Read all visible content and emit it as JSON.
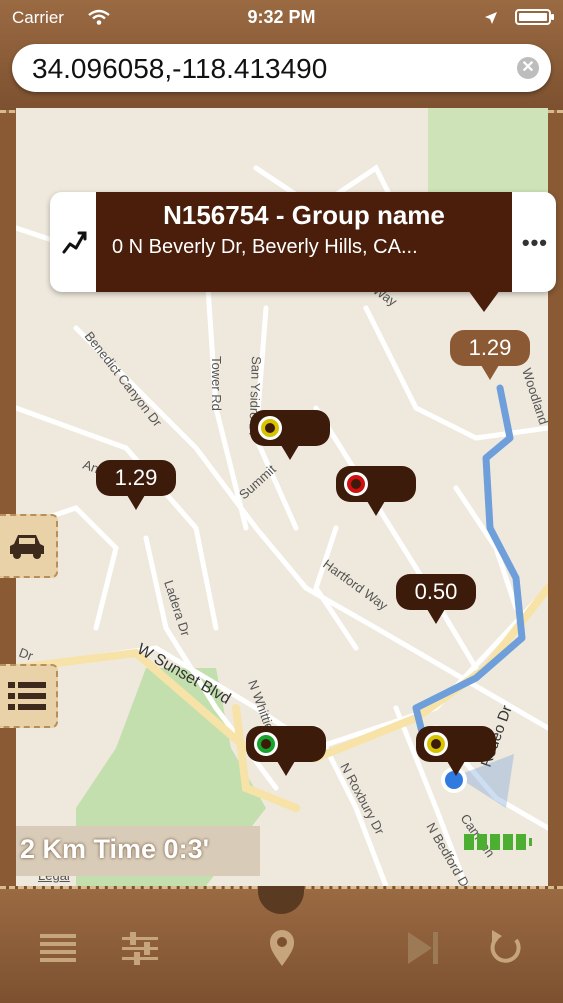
{
  "status_bar": {
    "carrier": "Carrier",
    "wifi_icon": "wifi-icon",
    "time": "9:32 PM",
    "location_icon": "location-arrow-icon",
    "battery_icon": "battery-icon"
  },
  "search": {
    "value": "34.096058,-118.413490",
    "clear_icon": "clear-icon",
    "clear_glyph": "✕"
  },
  "callout": {
    "title": "N156754 - Group name",
    "address": "0 N Beverly Dr, Beverly Hills, CA...",
    "route_icon": "route-icon",
    "more_icon": "more-icon",
    "more_glyph": "•••"
  },
  "map": {
    "streets": [
      "Benedict Canyon Dr",
      "Tower Rd",
      "San Ysidro Dr",
      "Summit",
      "Angelo Dr",
      "Hartford Way",
      "Ladera Dr",
      "W Sunset Blvd",
      "N Whittier",
      "N Roxbury Dr",
      "N Bedford Dr",
      "Rodeo Dr",
      "Woodland",
      "Way",
      "Dr",
      "Camden"
    ],
    "pins": [
      {
        "label": "1.29",
        "style": "tan"
      },
      {
        "label": "1.29",
        "style": "dark"
      },
      {
        "label": "",
        "style": "dark",
        "dot": "yellow"
      },
      {
        "label": "",
        "style": "dark",
        "dot": "red"
      },
      {
        "label": "0.50",
        "style": "dark"
      },
      {
        "label": "",
        "style": "dark",
        "dot": "green"
      },
      {
        "label": "",
        "style": "dark",
        "dot": "yellow"
      }
    ],
    "colors": {
      "route": "#6f9fdb",
      "pin_dark": "#3d1b0b",
      "pin_tan": "#8b5a34",
      "dot_yellow": "#d8c300",
      "dot_red": "#d01010",
      "dot_green": "#16a52a"
    },
    "legal": "Legal"
  },
  "side_tabs": [
    {
      "icon": "car-icon"
    },
    {
      "icon": "list-icon"
    }
  ],
  "info_banner": {
    "text": "2 Km Time 0:3'"
  },
  "signal": {
    "icon": "battery-level-icon",
    "level_fraction": 1.0
  },
  "toolbar": {
    "items": [
      {
        "icon": "menu-icon"
      },
      {
        "icon": "sliders-icon"
      },
      {
        "icon": "location-pin-icon"
      },
      {
        "icon": "skip-forward-icon"
      },
      {
        "icon": "refresh-icon"
      }
    ]
  }
}
